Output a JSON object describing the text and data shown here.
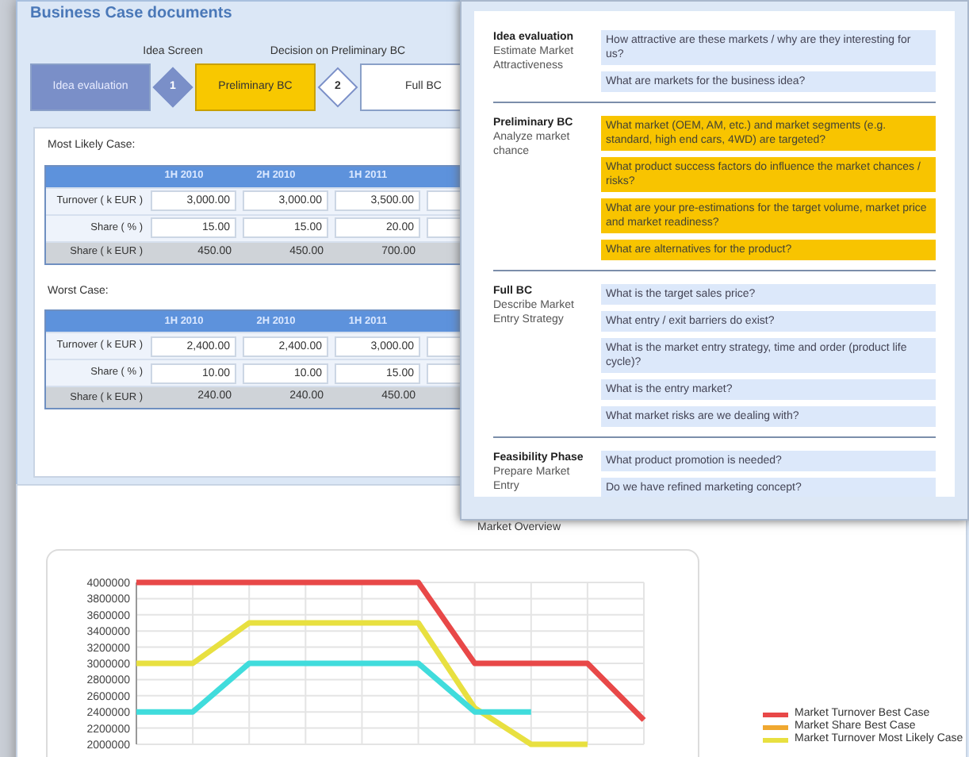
{
  "window": {
    "title": "Business Case documents"
  },
  "process": [
    {
      "kind": "step",
      "label": "Idea evaluation",
      "completed": true,
      "selected": false
    },
    {
      "kind": "gate",
      "number": "1",
      "caption": "Idea Screen"
    },
    {
      "kind": "step",
      "label": "Preliminary BC",
      "completed": false,
      "selected": true
    },
    {
      "kind": "gate",
      "number": "2",
      "caption": "Decision on Preliminary BC"
    },
    {
      "kind": "step",
      "label": "Full BC",
      "completed": false,
      "selected": false
    }
  ],
  "cases": [
    {
      "title": "Most Likely Case:",
      "columns": [
        "1H 2010",
        "2H 2010",
        "1H 2011"
      ],
      "rows": [
        {
          "kind": "input",
          "label": "Turnover ( k EUR )",
          "cells": [
            "3,000.00",
            "3,000.00",
            "3,500.00",
            ""
          ]
        },
        {
          "kind": "input",
          "label": "Share ( % )",
          "cells": [
            "15.00",
            "15.00",
            "20.00",
            ""
          ]
        },
        {
          "kind": "total",
          "label": "Share ( k EUR )",
          "cells": [
            "450.00",
            "450.00",
            "700.00",
            ""
          ]
        }
      ]
    },
    {
      "title": "Worst Case:",
      "columns": [
        "1H 2010",
        "2H 2010",
        "1H 2011"
      ],
      "rows": [
        {
          "kind": "input",
          "label": "Turnover ( k EUR )",
          "cells": [
            "2,400.00",
            "2,400.00",
            "3,000.00",
            ""
          ]
        },
        {
          "kind": "input",
          "label": "Share ( % )",
          "cells": [
            "10.00",
            "10.00",
            "15.00",
            ""
          ]
        },
        {
          "kind": "total",
          "label": "Share ( k EUR )",
          "cells": [
            "240.00",
            "240.00",
            "450.00",
            ""
          ]
        }
      ]
    }
  ],
  "questions_panel": {
    "sections": [
      {
        "title": "Idea evaluation",
        "subtitle": "Estimate Market Attractiveness",
        "active": false,
        "questions": [
          "How attractive are these markets / why are they interesting for us?",
          "What are markets for the business idea?"
        ]
      },
      {
        "title": "Preliminary BC",
        "subtitle": "Analyze market chance",
        "active": true,
        "questions": [
          "What market (OEM, AM, etc.) and market segments (e.g. standard, high end cars, 4WD) are targeted?",
          "What product success factors do influence the market chances / risks?",
          "What are your pre-estimations for the target volume, market price and market readiness?",
          "What are alternatives for the product?"
        ]
      },
      {
        "title": "Full BC",
        "subtitle": "Describe Market Entry Strategy",
        "active": false,
        "questions": [
          "What is the target sales price?",
          "What entry / exit barriers do exist?",
          "What is the market entry strategy, time and order (product life cycle)?",
          "What is the entry market?",
          "What market risks are we dealing with?"
        ]
      },
      {
        "title": "Feasibility Phase",
        "subtitle": "Prepare Market Entry",
        "active": false,
        "questions": [
          "What product promotion is needed?",
          "Do we have refined marketing concept?"
        ]
      }
    ]
  },
  "chart": {
    "chart_data": {
      "type": "line",
      "title": "Market Overview",
      "grid": true,
      "ylim": [
        2000000,
        4000000
      ],
      "yticks": [
        2000000,
        2200000,
        2400000,
        2600000,
        2800000,
        3000000,
        3200000,
        3400000,
        3600000,
        3800000,
        4000000
      ],
      "series": [
        {
          "color": "#e84848",
          "values": [
            4000000,
            4000000,
            4000000,
            4000000,
            4000000,
            4000000,
            3000000,
            3000000,
            3000000,
            2300000
          ]
        },
        {
          "color": "#e8e040",
          "values": [
            3000000,
            3000000,
            3500000,
            3500000,
            3500000,
            3500000,
            2450000,
            2000000,
            2000000,
            null
          ]
        },
        {
          "color": "#40dcdc",
          "values": [
            2400000,
            2400000,
            3000000,
            3000000,
            3000000,
            3000000,
            2400000,
            2400000,
            null,
            null
          ]
        }
      ]
    },
    "legend": [
      {
        "label": "Market Turnover Best Case",
        "color": "#e84848"
      },
      {
        "label": "Market Share Best Case",
        "color": "#f0a830"
      },
      {
        "label": "Market Turnover Most Likely Case",
        "color": "#e8e040"
      }
    ]
  }
}
